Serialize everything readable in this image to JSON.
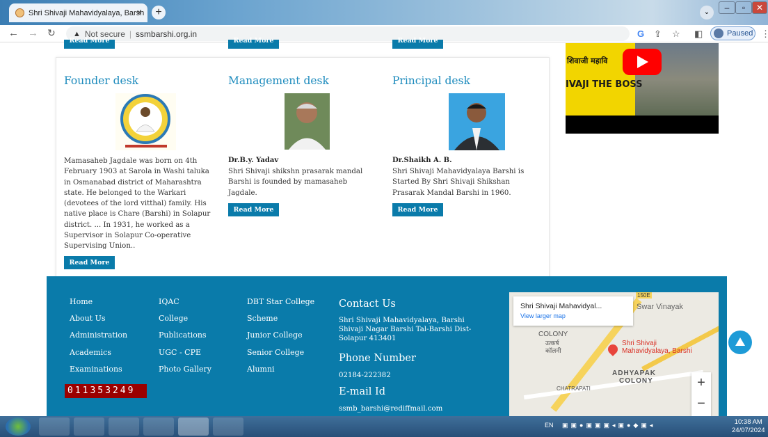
{
  "browser": {
    "tab_title": "Shri Shivaji Mahavidyalaya, Barsh",
    "tab_close": "×",
    "new_tab": "+",
    "url_security": "Not secure",
    "url": "ssmbarshi.org.in",
    "profile_status": "Paused",
    "window_controls": [
      "–",
      "▫",
      "✕"
    ]
  },
  "desks": [
    {
      "title": "Founder desk",
      "name": "",
      "text": "Mamasaheb Jagdale was born on 4th February 1903 at Sarola in Washi taluka in Osmanabad district of Maharashtra state. He belonged to the Warkari (devotees of the lord vitthal) family. His native place is Chare (Barshi) in Solapur district. ... In 1931, he worked as a Supervisor in Solapur Co-operative Supervising Union..",
      "button": "Read More"
    },
    {
      "title": "Management desk",
      "name": "Dr.B.y. Yadav",
      "text": "Shri Shivaji shikshn prasarak mandal Barshi is founded by mamasaheb Jagdale.",
      "button": "Read More"
    },
    {
      "title": "Principal desk",
      "name": "Dr.Shaikh A. B.",
      "text": "Shri Shivaji Mahavidyalaya Barshi is Started By Shri Shivaji Shikshan Prasarak Mandal Barshi in 1960.",
      "button": "Read More"
    }
  ],
  "top_buttons": [
    "Read More",
    "Read More",
    "Read More"
  ],
  "video": {
    "line1": "शिवाजी महावि",
    "line2": "IVAJI THE BOSS"
  },
  "footer": {
    "col1": [
      "Home",
      "About Us",
      "Administration",
      "Academics",
      "Examinations"
    ],
    "col2": [
      "IQAC",
      "College",
      "Publications",
      "UGC - CPE",
      "Photo Gallery"
    ],
    "col3": [
      "DBT Star College",
      "Scheme",
      "Junior College",
      "Senior College",
      "Alumni"
    ],
    "counter": "011353249",
    "contact_heading": "Contact Us",
    "address_line1": "Shri Shivaji Mahavidyalaya, Barshi",
    "address_line2": "Shivaji Nagar Barshi Tal-Barshi Dist-",
    "address_line3": "Solapur 413401",
    "phone_heading": "Phone Number",
    "phone": "02184-222382",
    "email_heading": "E-mail Id",
    "email": "ssmb_barshi@rediffmail.com"
  },
  "map": {
    "place": "Shri Shivaji Mahavidyal...",
    "view_larger": "View larger map",
    "swar": "Swar Vinayak",
    "colony": "COLONY",
    "colony_mr": "उत्कर्ष",
    "colony_mr2": "कॉलनी",
    "pin_label1": "Shri Shivaji",
    "pin_label2": "Mahavidyalaya, Barshi",
    "adhyapak": "ADHYAPAK",
    "adhyapak2": "COLONY",
    "chatrapati": "CHATRAPATI",
    "road": "150E",
    "zoom_in": "+",
    "zoom_out": "−"
  },
  "taskbar": {
    "lang": "EN",
    "time": "10:38 AM",
    "date": "24/07/2024"
  }
}
